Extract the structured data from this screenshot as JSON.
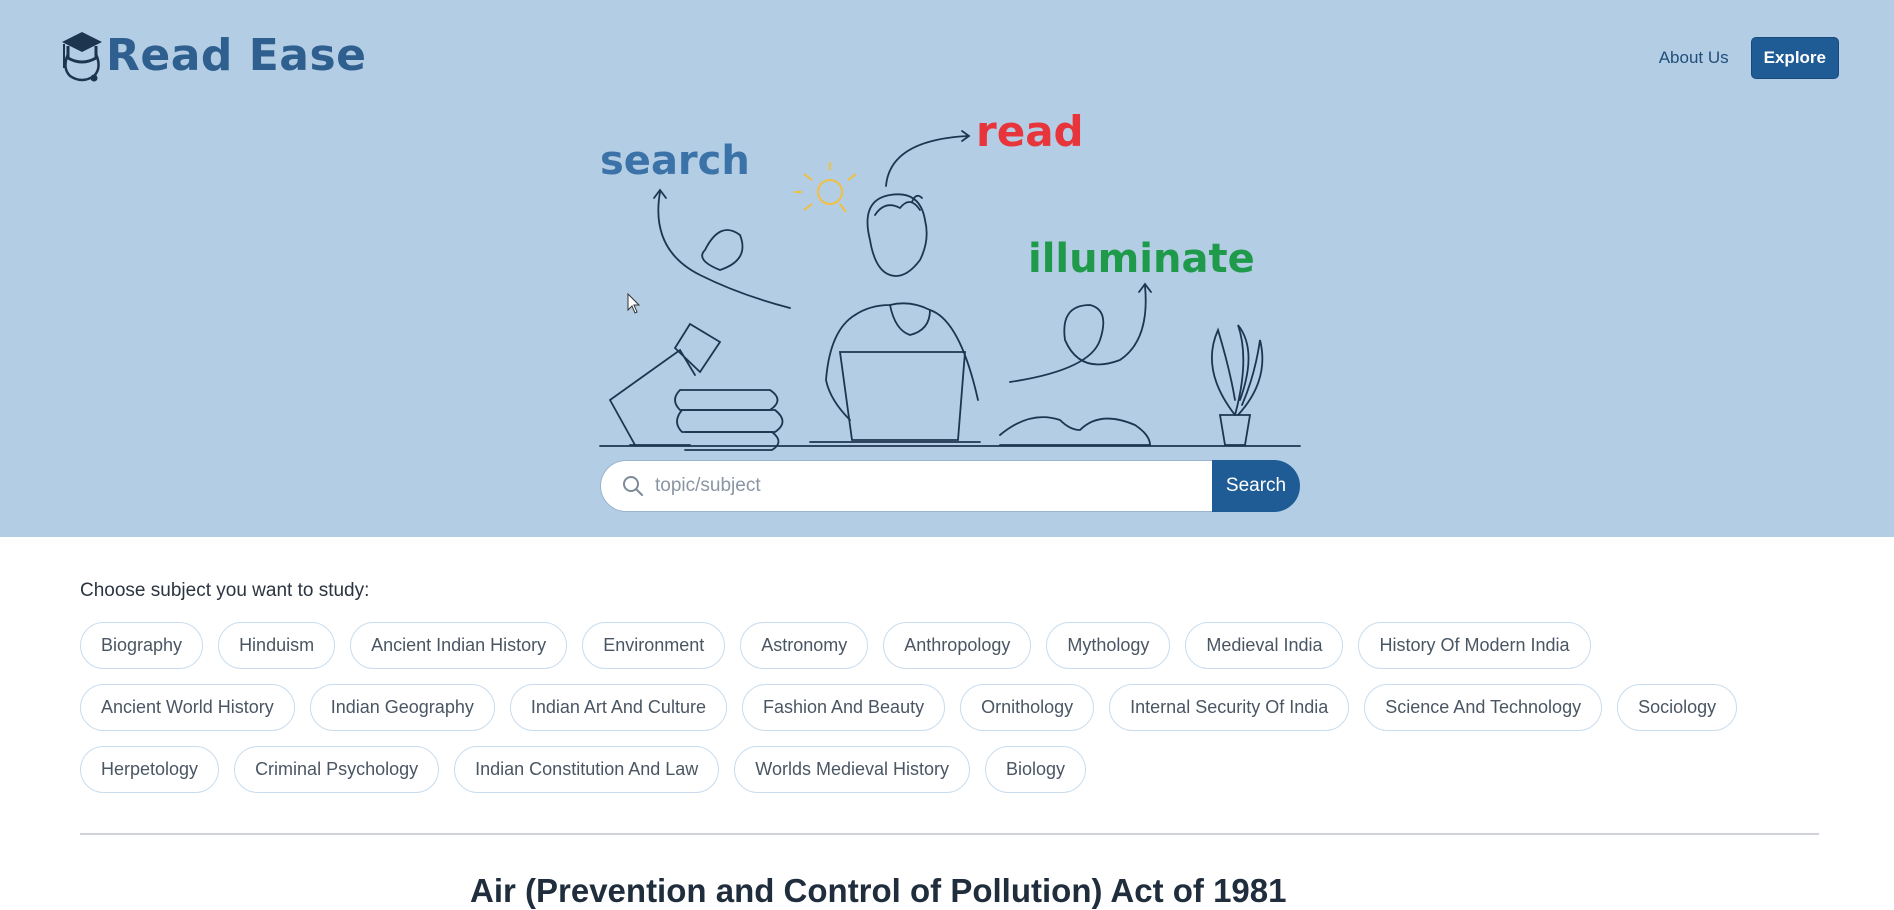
{
  "header": {
    "app_name": "Read Ease",
    "nav": {
      "about_label": "About Us",
      "explore_label": "Explore"
    }
  },
  "hero": {
    "words": {
      "search": "search",
      "read": "read",
      "illuminate": "illuminate"
    },
    "colors": {
      "search": "#3b72a8",
      "read": "#e8353b",
      "illuminate": "#1f9a4a",
      "bulb": "#f0c040",
      "line": "#1e3550"
    }
  },
  "search": {
    "placeholder": "topic/subject",
    "button_label": "Search"
  },
  "subjects": {
    "title": "Choose subject you want to study:",
    "items": [
      "Biography",
      "Hinduism",
      "Ancient Indian History",
      "Environment",
      "Astronomy",
      "Anthropology",
      "Mythology",
      "Medieval India",
      "History Of Modern India",
      "Ancient World History",
      "Indian Geography",
      "Indian Art And Culture",
      "Fashion And Beauty",
      "Ornithology",
      "Internal Security Of India",
      "Science And Technology",
      "Sociology",
      "Herpetology",
      "Criminal Psychology",
      "Indian Constitution And Law",
      "Worlds Medieval History",
      "Biology"
    ]
  },
  "article": {
    "title": "Air (Prevention and Control of Pollution) Act of 1981"
  },
  "theme": {
    "hero_bg": "#b3cde4",
    "primary": "#1f5c96",
    "brand": "#2f5f8e"
  }
}
